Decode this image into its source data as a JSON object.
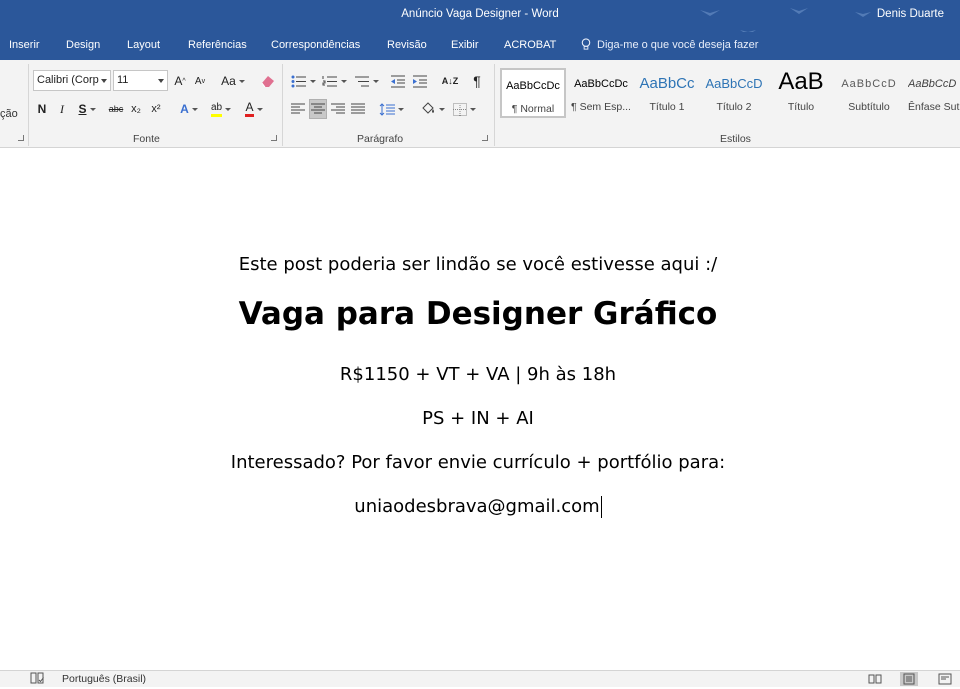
{
  "window": {
    "title": "Anúncio Vaga Designer  -  Word",
    "user": "Denis Duarte"
  },
  "tabs": [
    "Inserir",
    "Design",
    "Layout",
    "Referências",
    "Correspondências",
    "Revisão",
    "Exibir",
    "ACROBAT"
  ],
  "tell_me": {
    "placeholder": "Diga-me o que você deseja fazer",
    "icon": "lightbulb-icon"
  },
  "ribbon": {
    "clipboard_partial_label": "ção",
    "font": {
      "group_label": "Fonte",
      "font_name": "Calibri (Corp",
      "font_size": "11",
      "grow_label": "A",
      "shrink_label": "A",
      "change_case_label": "Aa",
      "bold_label": "N",
      "italic_label": "I",
      "underline_label": "S",
      "strike_label": "abc",
      "subscript_label": "x₂",
      "superscript_label": "x²",
      "text_effects_label": "A",
      "highlight_label": "ab",
      "font_color_label": "A",
      "highlight_color": "#ffff00",
      "font_color": "#e02020"
    },
    "paragraph": {
      "group_label": "Parágrafo",
      "sort_label": "A↓Z",
      "show_marks_label": "¶"
    },
    "styles": {
      "group_label": "Estilos",
      "items": [
        {
          "sample": "AaBbCcDc",
          "name": "¶ Normal"
        },
        {
          "sample": "AaBbCcDc",
          "name": "¶ Sem Esp..."
        },
        {
          "sample": "AaBbCc",
          "name": "Título 1"
        },
        {
          "sample": "AaBbCcD",
          "name": "Título 2"
        },
        {
          "sample": "AaB",
          "name": "Título"
        },
        {
          "sample": "AaBbCcD",
          "name": "Subtítulo"
        },
        {
          "sample": "AaBbCcD",
          "name": "Ênfase Sut"
        }
      ]
    }
  },
  "document": {
    "line1": "Este post poderia ser lindão se você estivesse aqui :/",
    "heading": "Vaga para Designer Gráfico",
    "line3": "R$1150 + VT + VA | 9h às 18h",
    "line4": "PS + IN + AI",
    "line5": "Interessado? Por favor envie currículo + portfólio para:",
    "line6": "uniaodesbrava@gmail.com"
  },
  "status_bar": {
    "language": "Português (Brasil)"
  },
  "colors": {
    "title_bar": "#2b579a",
    "ribbon_bg": "#f3f3f3",
    "heading_color_sample": "#2e74b5"
  }
}
